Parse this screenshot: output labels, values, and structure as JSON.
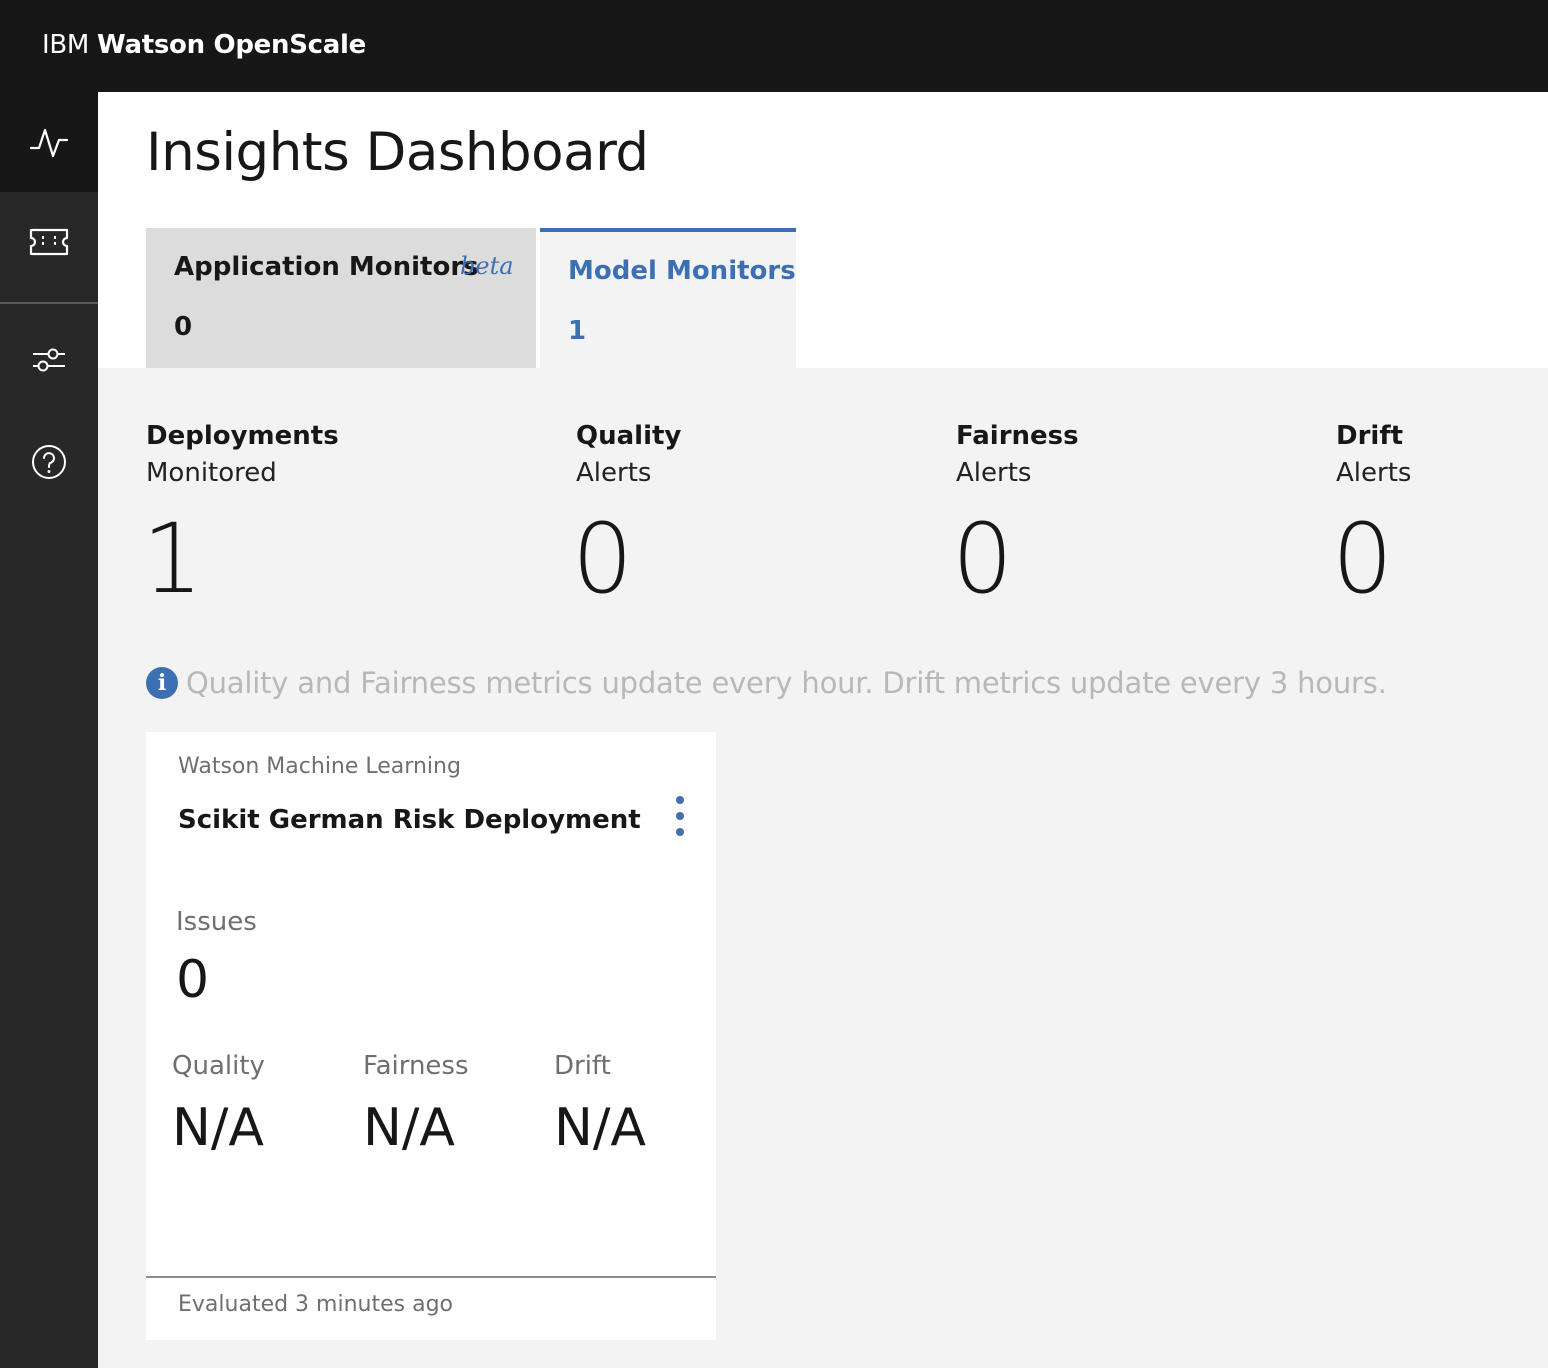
{
  "app": {
    "brand_prefix": "IBM",
    "brand_name": "Watson OpenScale"
  },
  "sidenav": {
    "items": [
      {
        "icon": "activity-icon",
        "active": true
      },
      {
        "icon": "ticket-icon",
        "active": false
      },
      {
        "icon": "sliders-icon",
        "active": false
      },
      {
        "icon": "help-icon",
        "active": false
      }
    ]
  },
  "page": {
    "title": "Insights Dashboard"
  },
  "tabs": [
    {
      "label": "Application Monitors",
      "badge": "beta",
      "count": "0",
      "selected": false
    },
    {
      "label": "Model Monitors",
      "count": "1",
      "selected": true
    }
  ],
  "stats": [
    {
      "title": "Deployments",
      "subtitle": "Monitored",
      "value": "1"
    },
    {
      "title": "Quality",
      "subtitle": "Alerts",
      "value": "0"
    },
    {
      "title": "Fairness",
      "subtitle": "Alerts",
      "value": "0"
    },
    {
      "title": "Drift",
      "subtitle": "Alerts",
      "value": "0"
    }
  ],
  "info": {
    "icon": "info-icon",
    "text": "Quality and Fairness metrics update every hour. Drift metrics update every 3 hours."
  },
  "deployment_card": {
    "provider": "Watson Machine Learning",
    "name": "Scikit German Risk Deployment",
    "issues_label": "Issues",
    "issues_value": "0",
    "metrics": [
      {
        "label": "Quality",
        "value": "N/A"
      },
      {
        "label": "Fairness",
        "value": "N/A"
      },
      {
        "label": "Drift",
        "value": "N/A"
      }
    ],
    "footer": "Evaluated 3 minutes ago"
  },
  "colors": {
    "accent": "#3d70b2",
    "topbar": "#171717",
    "sidenav": "#282828"
  }
}
